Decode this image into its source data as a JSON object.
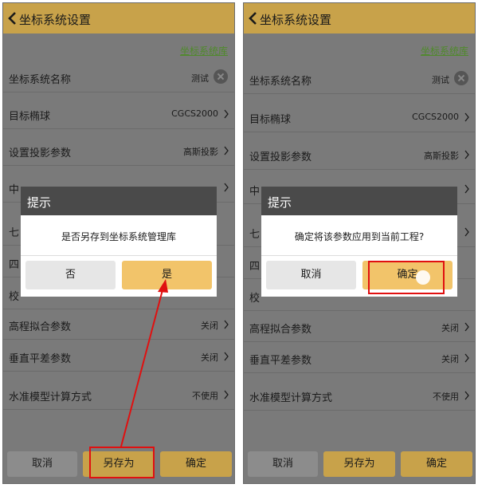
{
  "left": {
    "header_title": "坐标系统设置",
    "lib_link": "坐标系统库",
    "rows": [
      {
        "label": "坐标系统名称",
        "value": "测试"
      },
      {
        "label": "目标椭球",
        "value": "CGCS2000"
      },
      {
        "label": "设置投影参数",
        "value": "高斯投影"
      },
      {
        "label": "中",
        "value": ""
      },
      {
        "label": "七",
        "value": ""
      },
      {
        "label": "四",
        "value": ""
      },
      {
        "label": "校",
        "value": ""
      },
      {
        "label": "高程拟合参数",
        "value": "关闭"
      },
      {
        "label": "垂直平差参数",
        "value": "关闭"
      },
      {
        "label": "水准模型计算方式",
        "value": "不使用"
      }
    ],
    "buttons": {
      "cancel": "取消",
      "saveas": "另存为",
      "ok": "确定"
    },
    "dialog": {
      "title": "提示",
      "message": "是否另存到坐标系统管理库",
      "no": "否",
      "yes": "是"
    }
  },
  "right": {
    "header_title": "坐标系统设置",
    "lib_link": "坐标系统库",
    "rows": [
      {
        "label": "坐标系统名称",
        "value": "测试"
      },
      {
        "label": "目标椭球",
        "value": "CGCS2000"
      },
      {
        "label": "设置投影参数",
        "value": "高斯投影"
      },
      {
        "label": "中",
        "value": ""
      },
      {
        "label": "七",
        "value": ""
      },
      {
        "label": "四",
        "value": ""
      },
      {
        "label": "校",
        "value": ""
      },
      {
        "label": "高程拟合参数",
        "value": "关闭"
      },
      {
        "label": "垂直平差参数",
        "value": "关闭"
      },
      {
        "label": "水准模型计算方式",
        "value": "不使用"
      }
    ],
    "buttons": {
      "cancel": "取消",
      "saveas": "另存为",
      "ok": "确定"
    },
    "dialog": {
      "title": "提示",
      "message": "确定将该参数应用到当前工程?",
      "no": "取消",
      "yes": "确定"
    }
  },
  "colors": {
    "accent": "#c8a24a",
    "highlight": "#e01010",
    "link": "#4f8a2a"
  }
}
